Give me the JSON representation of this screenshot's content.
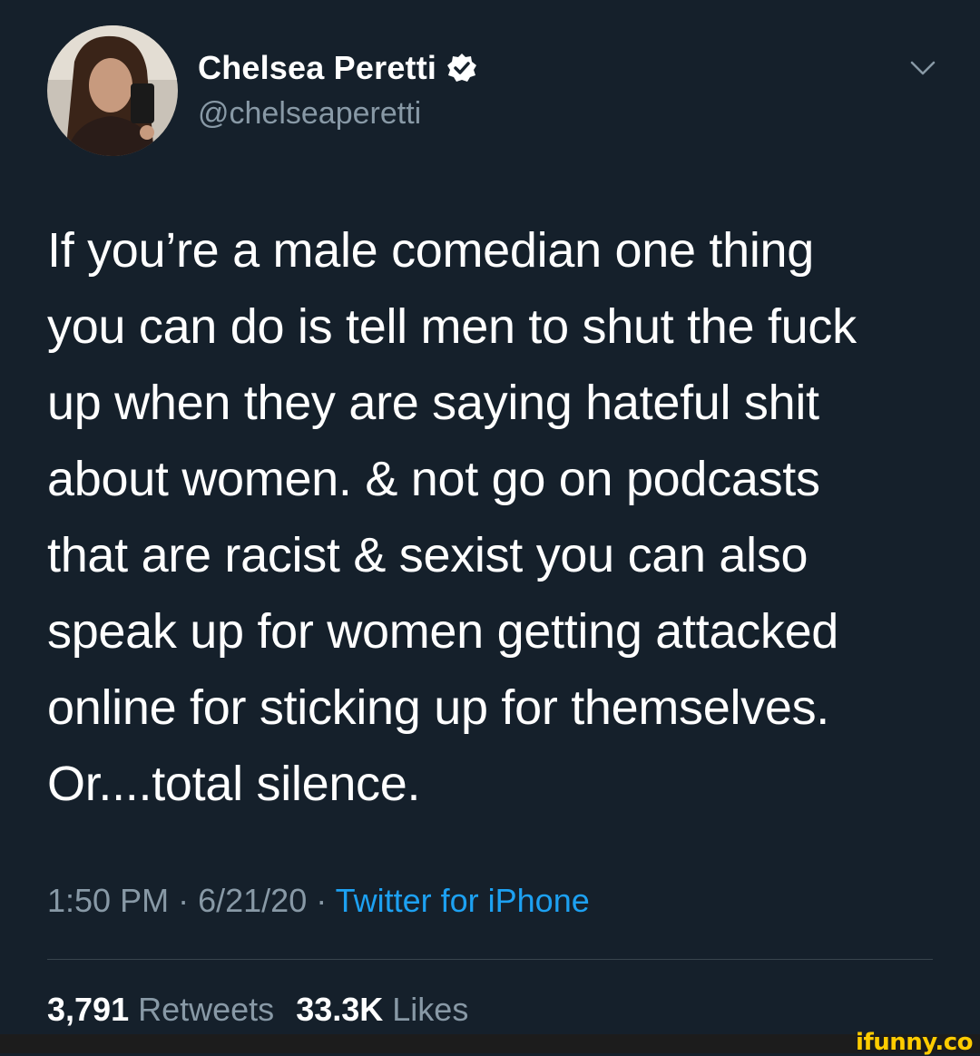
{
  "author": {
    "display_name": "Chelsea Peretti",
    "handle": "@chelseaperetti",
    "verified": true
  },
  "tweet": {
    "text": "If you’re a male comedian one thing\nyou can do is tell men to shut the fuck\nup when they are saying hateful shit\nabout women. & not go on podcasts\nthat are racist & sexist you can also\nspeak up for women getting attacked\nonline for sticking up for themselves.\nOr....total silence.",
    "time": "1:50 PM",
    "separator": "·",
    "date": "6/21/20",
    "source": "Twitter for iPhone"
  },
  "stats": {
    "retweets_count": "3,791",
    "retweets_label": "Retweets",
    "likes_count": "33.3K",
    "likes_label": "Likes"
  },
  "watermark": "ifunny.co",
  "colors": {
    "background": "#15202b",
    "primary_text": "#ffffff",
    "secondary_text": "#8899a6",
    "link": "#1da1f2",
    "divider": "#38444d"
  },
  "icons": {
    "verified": "verified-badge-icon",
    "more": "chevron-down-icon"
  }
}
